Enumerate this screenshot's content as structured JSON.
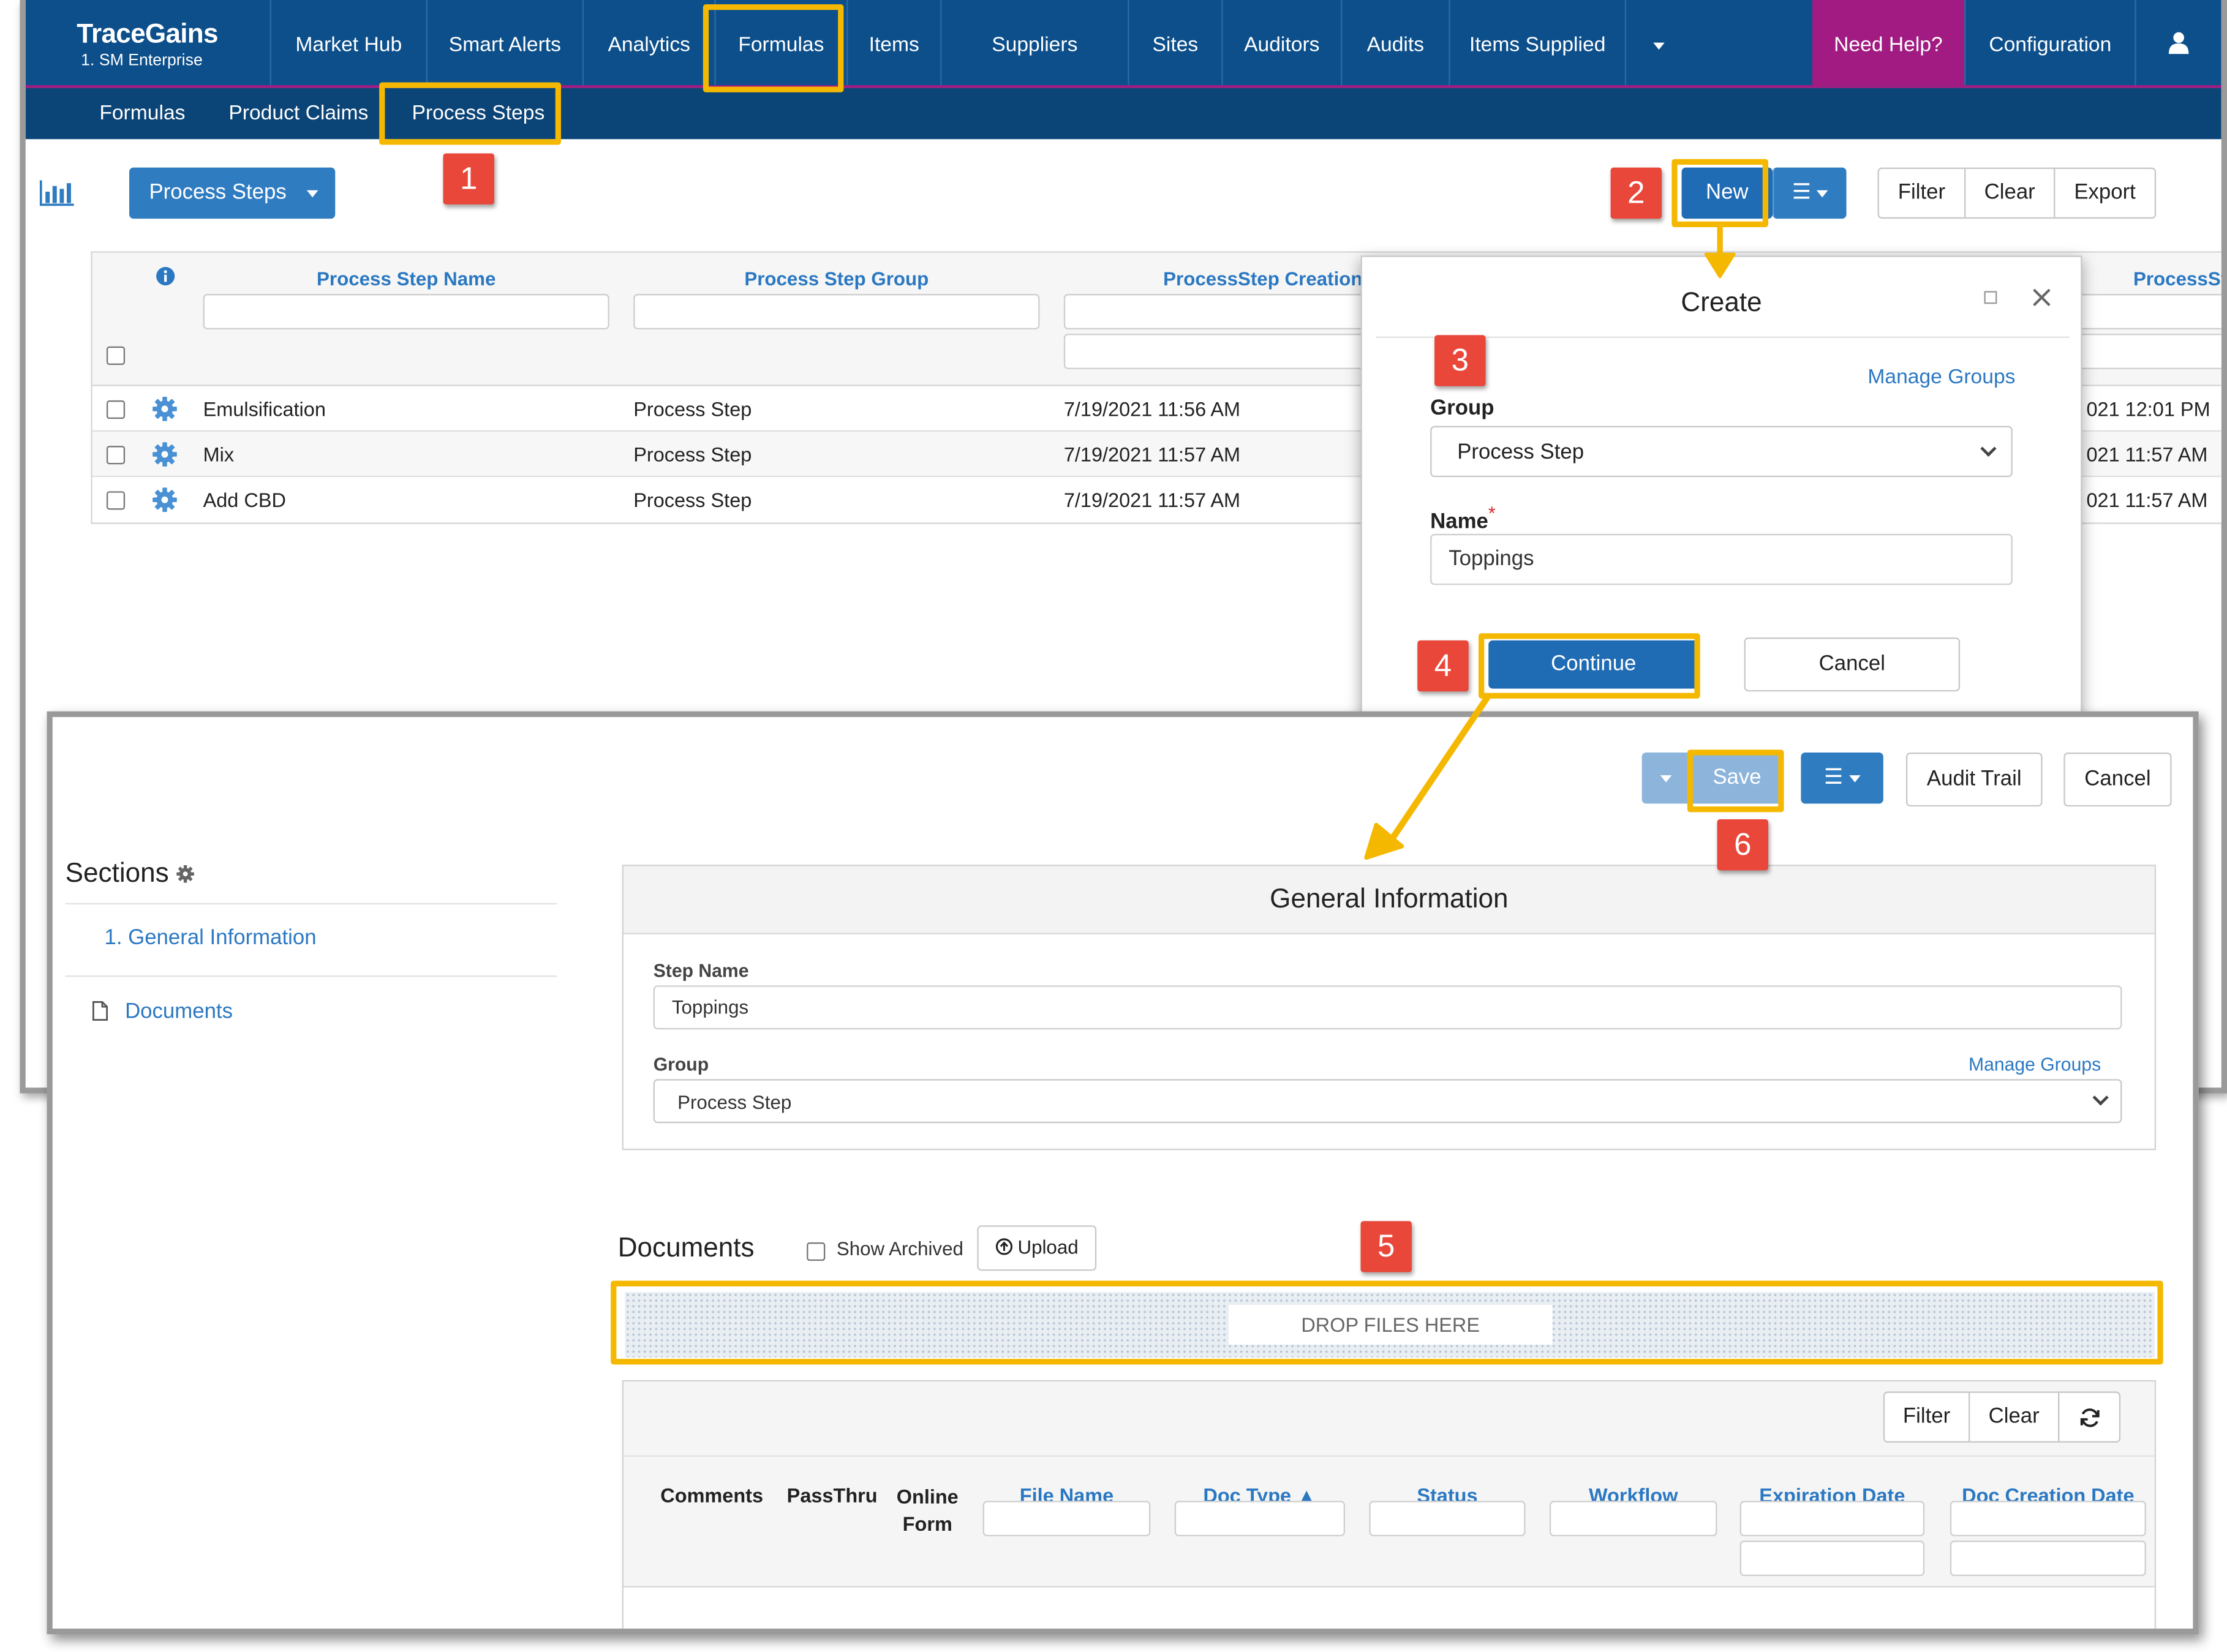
{
  "app": {
    "brand_name": "TraceGains",
    "brand_sub": "1. SM Enterprise"
  },
  "nav": {
    "items": [
      "Market Hub",
      "Smart Alerts",
      "Analytics",
      "Formulas",
      "Items",
      "Suppliers",
      "Sites",
      "Auditors",
      "Audits",
      "Items Supplied"
    ],
    "help": "Need Help?",
    "configuration": "Configuration"
  },
  "subnav": {
    "items": [
      "Formulas",
      "Product Claims",
      "Process Steps"
    ]
  },
  "list_page": {
    "view_select": "Process Steps",
    "new_button": "New",
    "filter_button": "Filter",
    "clear_button": "Clear",
    "export_button": "Export",
    "columns": [
      "Process Step Name",
      "Process Step Group",
      "ProcessStep Creation",
      "ProcessSt"
    ],
    "rows": [
      {
        "name": "Emulsification",
        "group": "Process Step",
        "created": "7/19/2021 11:56 AM",
        "modified": "021 12:01 PM"
      },
      {
        "name": "Mix",
        "group": "Process Step",
        "created": "7/19/2021 11:57 AM",
        "modified": "021 11:57 AM"
      },
      {
        "name": "Add CBD",
        "group": "Process Step",
        "created": "7/19/2021 11:57 AM",
        "modified": "021 11:57 AM"
      }
    ]
  },
  "modal": {
    "title": "Create",
    "manage_groups": "Manage Groups",
    "group_label": "Group",
    "group_value": "Process Step",
    "name_label": "Name",
    "required_mark": "*",
    "name_value": "Toppings",
    "continue_button": "Continue",
    "cancel_button": "Cancel"
  },
  "detail_page": {
    "save_button": "Save",
    "audit_trail_button": "Audit Trail",
    "cancel_button": "Cancel",
    "sections_title": "Sections",
    "sections": [
      "1. General Information"
    ],
    "documents_link": "Documents",
    "general_info_title": "General Information",
    "step_name_label": "Step Name",
    "step_name_value": "Toppings",
    "group_label": "Group",
    "group_value": "Process Step",
    "manage_groups": "Manage Groups",
    "documents_title": "Documents",
    "show_archived": "Show Archived",
    "upload_button": "Upload",
    "drop_files": "DROP FILES HERE",
    "doc_filter_button": "Filter",
    "doc_clear_button": "Clear",
    "doc_columns": [
      "Comments",
      "PassThru",
      "Online Form",
      "File Name",
      "Doc Type ▲",
      "Status",
      "Workflow",
      "Expiration Date",
      "Doc Creation Date"
    ]
  },
  "callouts": [
    "1",
    "2",
    "3",
    "4",
    "5",
    "6"
  ],
  "colors": {
    "nav_blue": "#0c4f8b",
    "subnav_blue": "#0b4476",
    "help_magenta": "#a21b82",
    "button_blue": "#2f7cc1",
    "link_blue": "#2b78c2",
    "highlight_yellow": "#f5b800",
    "callout_red": "#e9473a"
  }
}
